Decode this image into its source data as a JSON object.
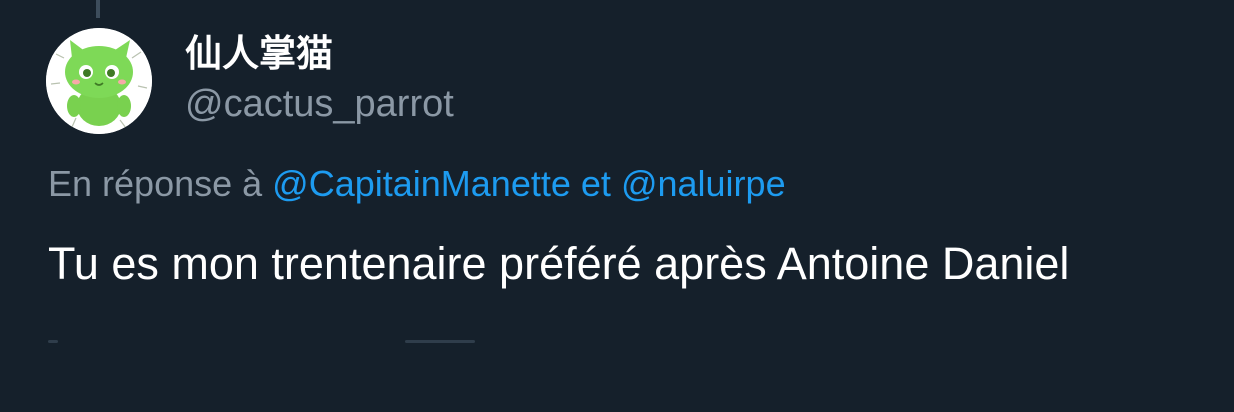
{
  "colors": {
    "background": "#15202b",
    "primary_text": "#ffffff",
    "secondary_text": "#8b98a5",
    "link": "#1d9bf0",
    "avatar_green": "#7ed957"
  },
  "author": {
    "display_name": "仙人掌猫",
    "handle": "@cactus_parrot",
    "avatar_icon": "cactus-cat-avatar-icon"
  },
  "reply_context": {
    "prefix": "En réponse à",
    "mention_1": "@CapitainManette",
    "connector": "et",
    "mention_2": "@naluirpe"
  },
  "tweet": {
    "text": "Tu es mon trentenaire préféré après Antoine Daniel"
  }
}
